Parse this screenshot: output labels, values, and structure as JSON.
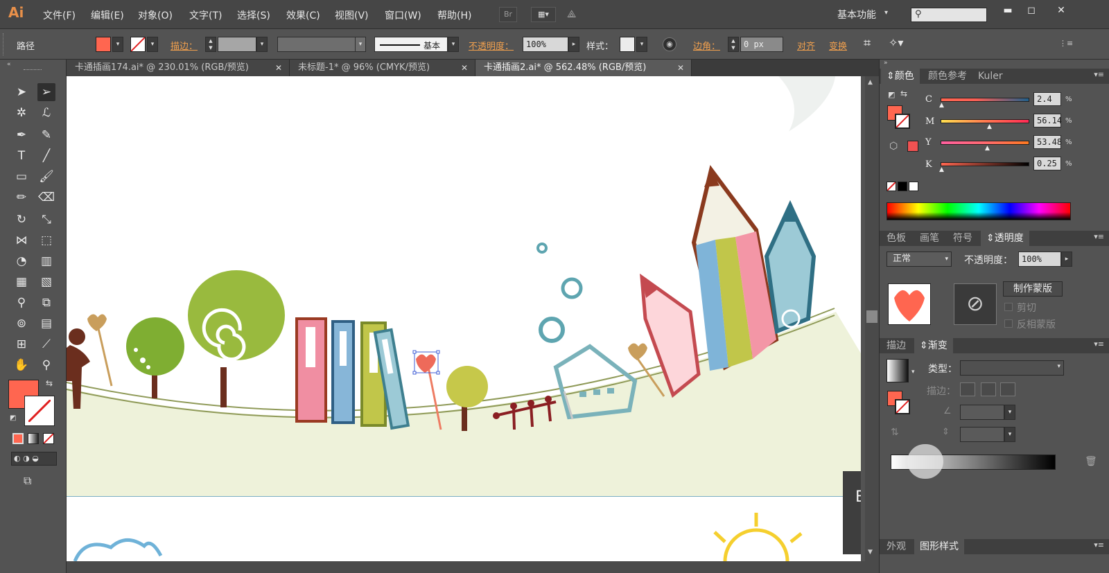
{
  "app": {
    "logo": "Ai"
  },
  "menu": {
    "items": [
      "文件(F)",
      "编辑(E)",
      "对象(O)",
      "文字(T)",
      "选择(S)",
      "效果(C)",
      "视图(V)",
      "窗口(W)",
      "帮助(H)"
    ],
    "bridge_label": "Br",
    "workspace": "基本功能",
    "search_placeholder": ""
  },
  "control_bar": {
    "object_type": "路径",
    "stroke_label": "描边：",
    "stroke_style": "基本",
    "opacity_label": "不透明度：",
    "opacity_value": "100%",
    "style_label": "样式：",
    "corner_label": "边角：",
    "corner_value": "0 px",
    "align_label": "对齐",
    "transform_label": "变换"
  },
  "tabs": [
    {
      "label": "卡通插画174.ai* @ 230.01% (RGB/预览)",
      "active": false
    },
    {
      "label": "未标题-1* @ 96% (CMYK/预览)",
      "active": false
    },
    {
      "label": "卡通插画2.ai* @ 562.48% (RGB/预览)",
      "active": true
    }
  ],
  "colors": {
    "fill": "#ff6650",
    "tree_green": "#8ab030",
    "ground": "#eef3da",
    "pencil_brown": "#8a3a1e",
    "teal": "#3e7f8f",
    "accent_orange": "#f1a04e"
  },
  "color_panel": {
    "tabs": [
      "颜色",
      "颜色参考",
      "Kuler"
    ],
    "channels": [
      {
        "name": "C",
        "value": "2.4",
        "gradient": "linear-gradient(90deg,#ff6650,#f95f55 40%,#1f5f8a)"
      },
      {
        "name": "M",
        "value": "56.14",
        "gradient": "linear-gradient(90deg,#ffe050,#ff7a50 50%,#ff2a55)"
      },
      {
        "name": "Y",
        "value": "53.48",
        "gradient": "linear-gradient(90deg,#ff60a0,#ff6a70 50%,#ff7a20)"
      },
      {
        "name": "K",
        "value": "0.25",
        "gradient": "linear-gradient(90deg,#ff6650,#7a3328 50%,#000)"
      }
    ],
    "unit": "%"
  },
  "transparency_panel": {
    "tabs": [
      "色板",
      "画笔",
      "符号",
      "透明度"
    ],
    "blend_mode": "正常",
    "opacity_label": "不透明度：",
    "opacity_value": "100%",
    "make_mask": "制作蒙版",
    "clip": "剪切",
    "invert_mask": "反相蒙版"
  },
  "gradient_panel": {
    "tabs": [
      "描边",
      "渐变"
    ],
    "type_label": "类型：",
    "type_value": "",
    "stroke_label": "描边："
  },
  "appearance_panel": {
    "tabs": [
      "外观",
      "图形样式"
    ]
  },
  "watermark": "Baidu"
}
